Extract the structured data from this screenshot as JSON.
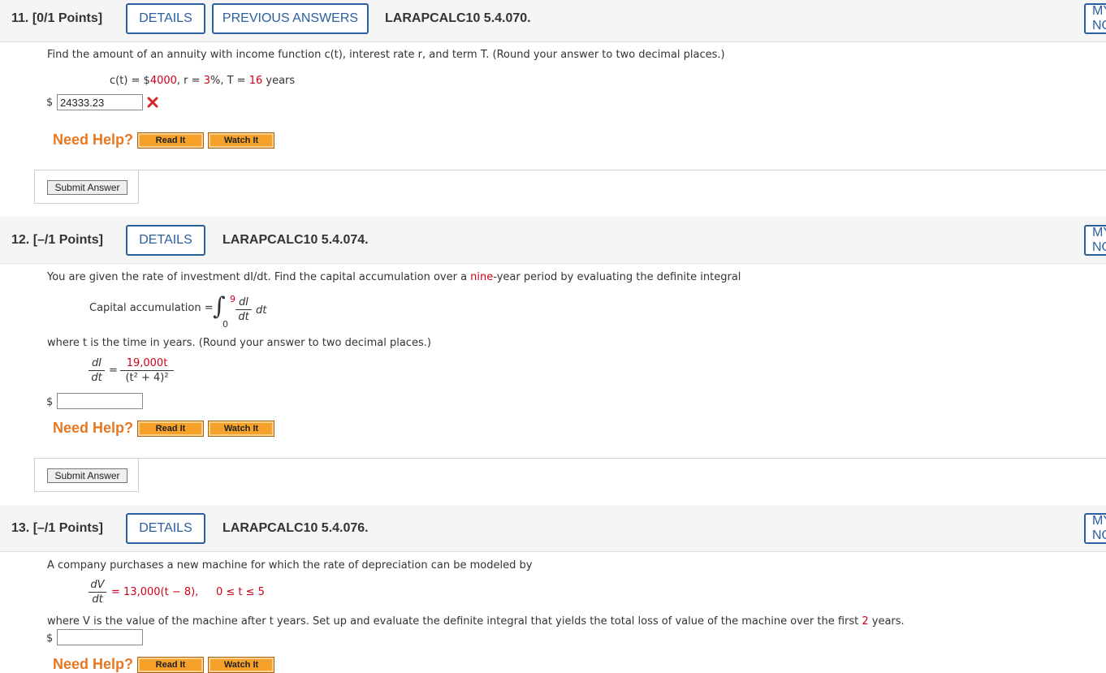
{
  "q11": {
    "number": "11.",
    "points": "[0/1 Points]",
    "details_label": "DETAILS",
    "prev_label": "PREVIOUS ANSWERS",
    "code": "LARAPCALC10 5.4.070.",
    "my_label": "MY NOTES",
    "prompt": "Find the amount of an annuity with income function c(t), interest rate r, and term T. (Round your answer to two decimal places.)",
    "given_lhs": "c(t) = $",
    "given_income": "4000",
    "given_r_lhs": ", r = ",
    "given_r": "3",
    "given_r_unit": "%, T = ",
    "given_T": "16",
    "given_T_unit": " years",
    "currency": "$",
    "answer_value": "24333.23",
    "status_icon": "incorrect-x-icon",
    "need_help": "Need Help?",
    "read_it": "Read It",
    "watch_it": "Watch It",
    "submit": "Submit Answer"
  },
  "q12": {
    "number": "12.",
    "points": "[–/1 Points]",
    "details_label": "DETAILS",
    "code": "LARAPCALC10 5.4.074.",
    "my_label": "MY NOTES",
    "prompt_a": "You are given the rate of investment dI/dt. Find the capital accumulation over a ",
    "prompt_red": "nine",
    "prompt_b": "-year period by evaluating the definite integral",
    "cap_label": "Capital accumulation =",
    "int_upper": "9",
    "int_lower": "0",
    "int_num": "dI",
    "int_den": "dt",
    "int_dt": "dt",
    "where_text": "where t is the time in years. (Round your answer to two decimal places.)",
    "rate_lhs_num": "dI",
    "rate_lhs_den": "dt",
    "rate_num": "19,000t",
    "rate_den": "(t² + 4)²",
    "currency": "$",
    "answer_value": "",
    "need_help": "Need Help?",
    "read_it": "Read It",
    "watch_it": "Watch It",
    "submit": "Submit Answer"
  },
  "q13": {
    "number": "13.",
    "points": "[–/1 Points]",
    "details_label": "DETAILS",
    "code": "LARAPCALC10 5.4.076.",
    "my_label": "MY NOTES",
    "prompt": "A company purchases a new machine for which the rate of depreciation can be modeled by",
    "eq_num": "dV",
    "eq_den": "dt",
    "eq_rhs": "= 13,000(t − 8),",
    "eq_domain": "0 ≤ t ≤ 5",
    "where_a": "where V is the value of the machine after t years. Set up and evaluate the definite integral that yields the total loss of value of the machine over the first ",
    "where_red": "2",
    "where_b": " years.",
    "currency": "$",
    "answer_value": "",
    "need_help": "Need Help?",
    "read_it": "Read It",
    "watch_it": "Watch It"
  },
  "colors": {
    "accent": "#2a5fa0",
    "help": "#e87722",
    "highlight": "#d0011b",
    "help_button": "#f6a22a"
  }
}
